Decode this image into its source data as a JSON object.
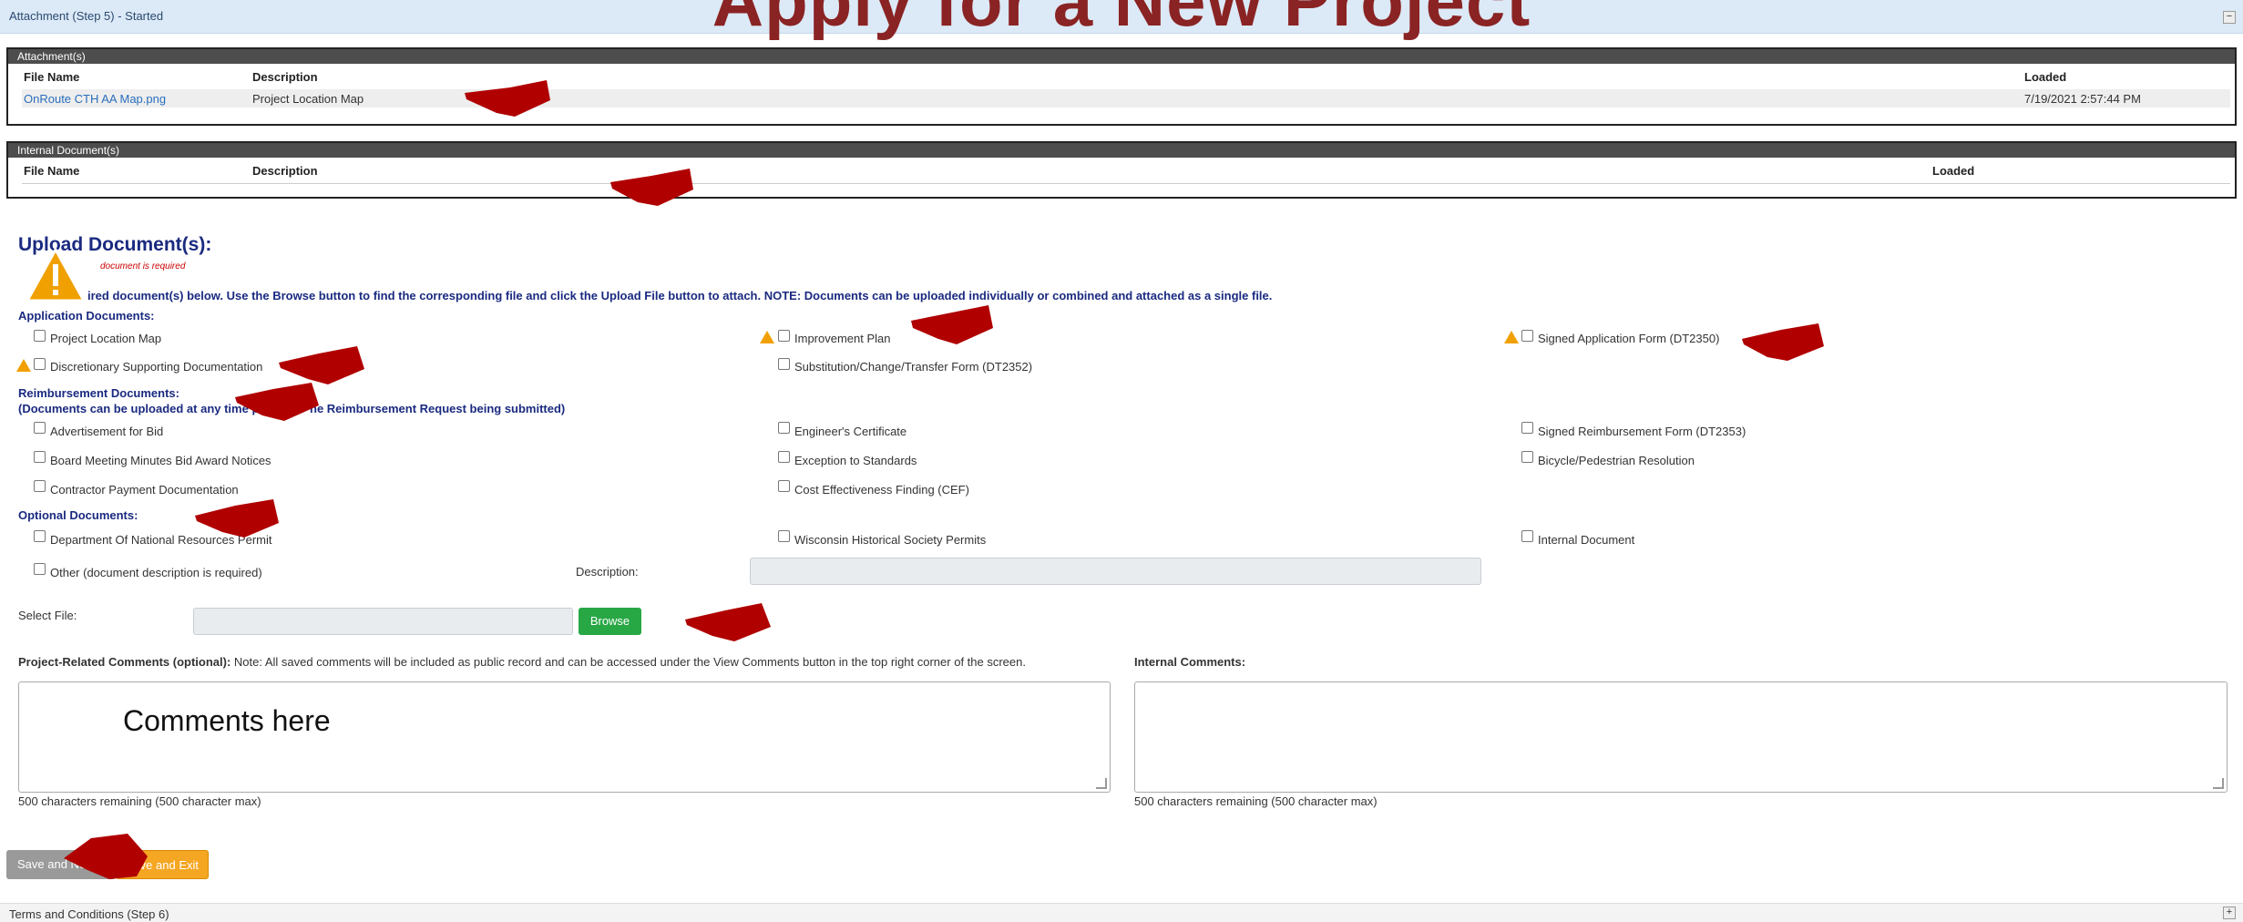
{
  "overlay_title": "Apply for a New Project",
  "step_header": {
    "label": "Attachment (Step 5) - Started",
    "collapse_symbol": "−"
  },
  "attachments": {
    "title": "Attachment(s)",
    "columns": {
      "file_name": "File Name",
      "description": "Description",
      "loaded": "Loaded"
    },
    "rows": [
      {
        "file_name": "OnRoute CTH AA Map.png",
        "description": "Project Location Map",
        "loaded": "7/19/2021 2:57:44 PM"
      }
    ]
  },
  "internal_documents": {
    "title": "Internal Document(s)",
    "columns": {
      "file_name": "File Name",
      "description": "Description",
      "loaded": "Loaded"
    }
  },
  "upload": {
    "title": "Upload Document(s):",
    "required_note": "document is required",
    "instructions": "ired document(s) below. Use the Browse button to find the corresponding file and click the Upload File button to attach. NOTE: Documents can be uploaded individually or combined and attached as a single file.",
    "application_label": "Application Documents:",
    "application_docs": {
      "project_location_map": "Project Location Map",
      "improvement_plan": "Improvement Plan",
      "signed_application_form": "Signed Application Form (DT2350)",
      "discretionary_supporting": "Discretionary Supporting Documentation",
      "substitution_change": "Substitution/Change/Transfer Form (DT2352)"
    },
    "reimbursement_label": "Reimbursement Documents:",
    "reimbursement_note": "(Documents can be uploaded at any time p",
    "reimbursement_note_end": "he Reimbursement Request being submitted)",
    "reimbursement_docs": {
      "advertisement_for_bid": "Advertisement for Bid",
      "engineers_certificate": "Engineer's Certificate",
      "signed_reimbursement_form": "Signed Reimbursement Form (DT2353)",
      "board_meeting_minutes": "Board Meeting Minutes Bid Award Notices",
      "exception_to_standards": "Exception to Standards",
      "bicycle_pedestrian": "Bicycle/Pedestrian Resolution",
      "contractor_payment": "Contractor Payment Documentation",
      "cost_effectiveness": "Cost Effectiveness Finding (CEF)"
    },
    "optional_label": "Optional Documents:",
    "optional_docs": {
      "dnr_permit": "Department Of National Resources Permit",
      "historical_society": "Wisconsin Historical Society Permits",
      "internal_document": "Internal Document",
      "other": "Other (document description is required)"
    },
    "description_label": "Description:",
    "select_file_label": "Select File:",
    "browse_label": "Browse"
  },
  "comments": {
    "project_label": "Project-Related Comments (optional):",
    "project_note": " Note: All saved comments will be included as public record and can be accessed under the View Comments button in the top right corner of the screen.",
    "project_placeholder_text": "Comments here",
    "project_remaining": "500 characters remaining (500 character max)",
    "internal_label": "Internal Comments:",
    "internal_remaining": "500 characters remaining (500 character max)"
  },
  "buttons": {
    "save_next": "Save and Next",
    "save_exit": "Save and Exit"
  },
  "footer": {
    "label": "Terms and Conditions (Step 6)",
    "expand_symbol": "+"
  },
  "colors": {
    "accent_header": "#dce9f6",
    "panel_head": "#4d4d4d",
    "browse": "#28a745",
    "save_exit": "#f5a623",
    "save_next": "#9a9a9a",
    "warning": "#f0a000",
    "annotation_arrow": "#b00000",
    "title_overlay": "#8a2323"
  }
}
